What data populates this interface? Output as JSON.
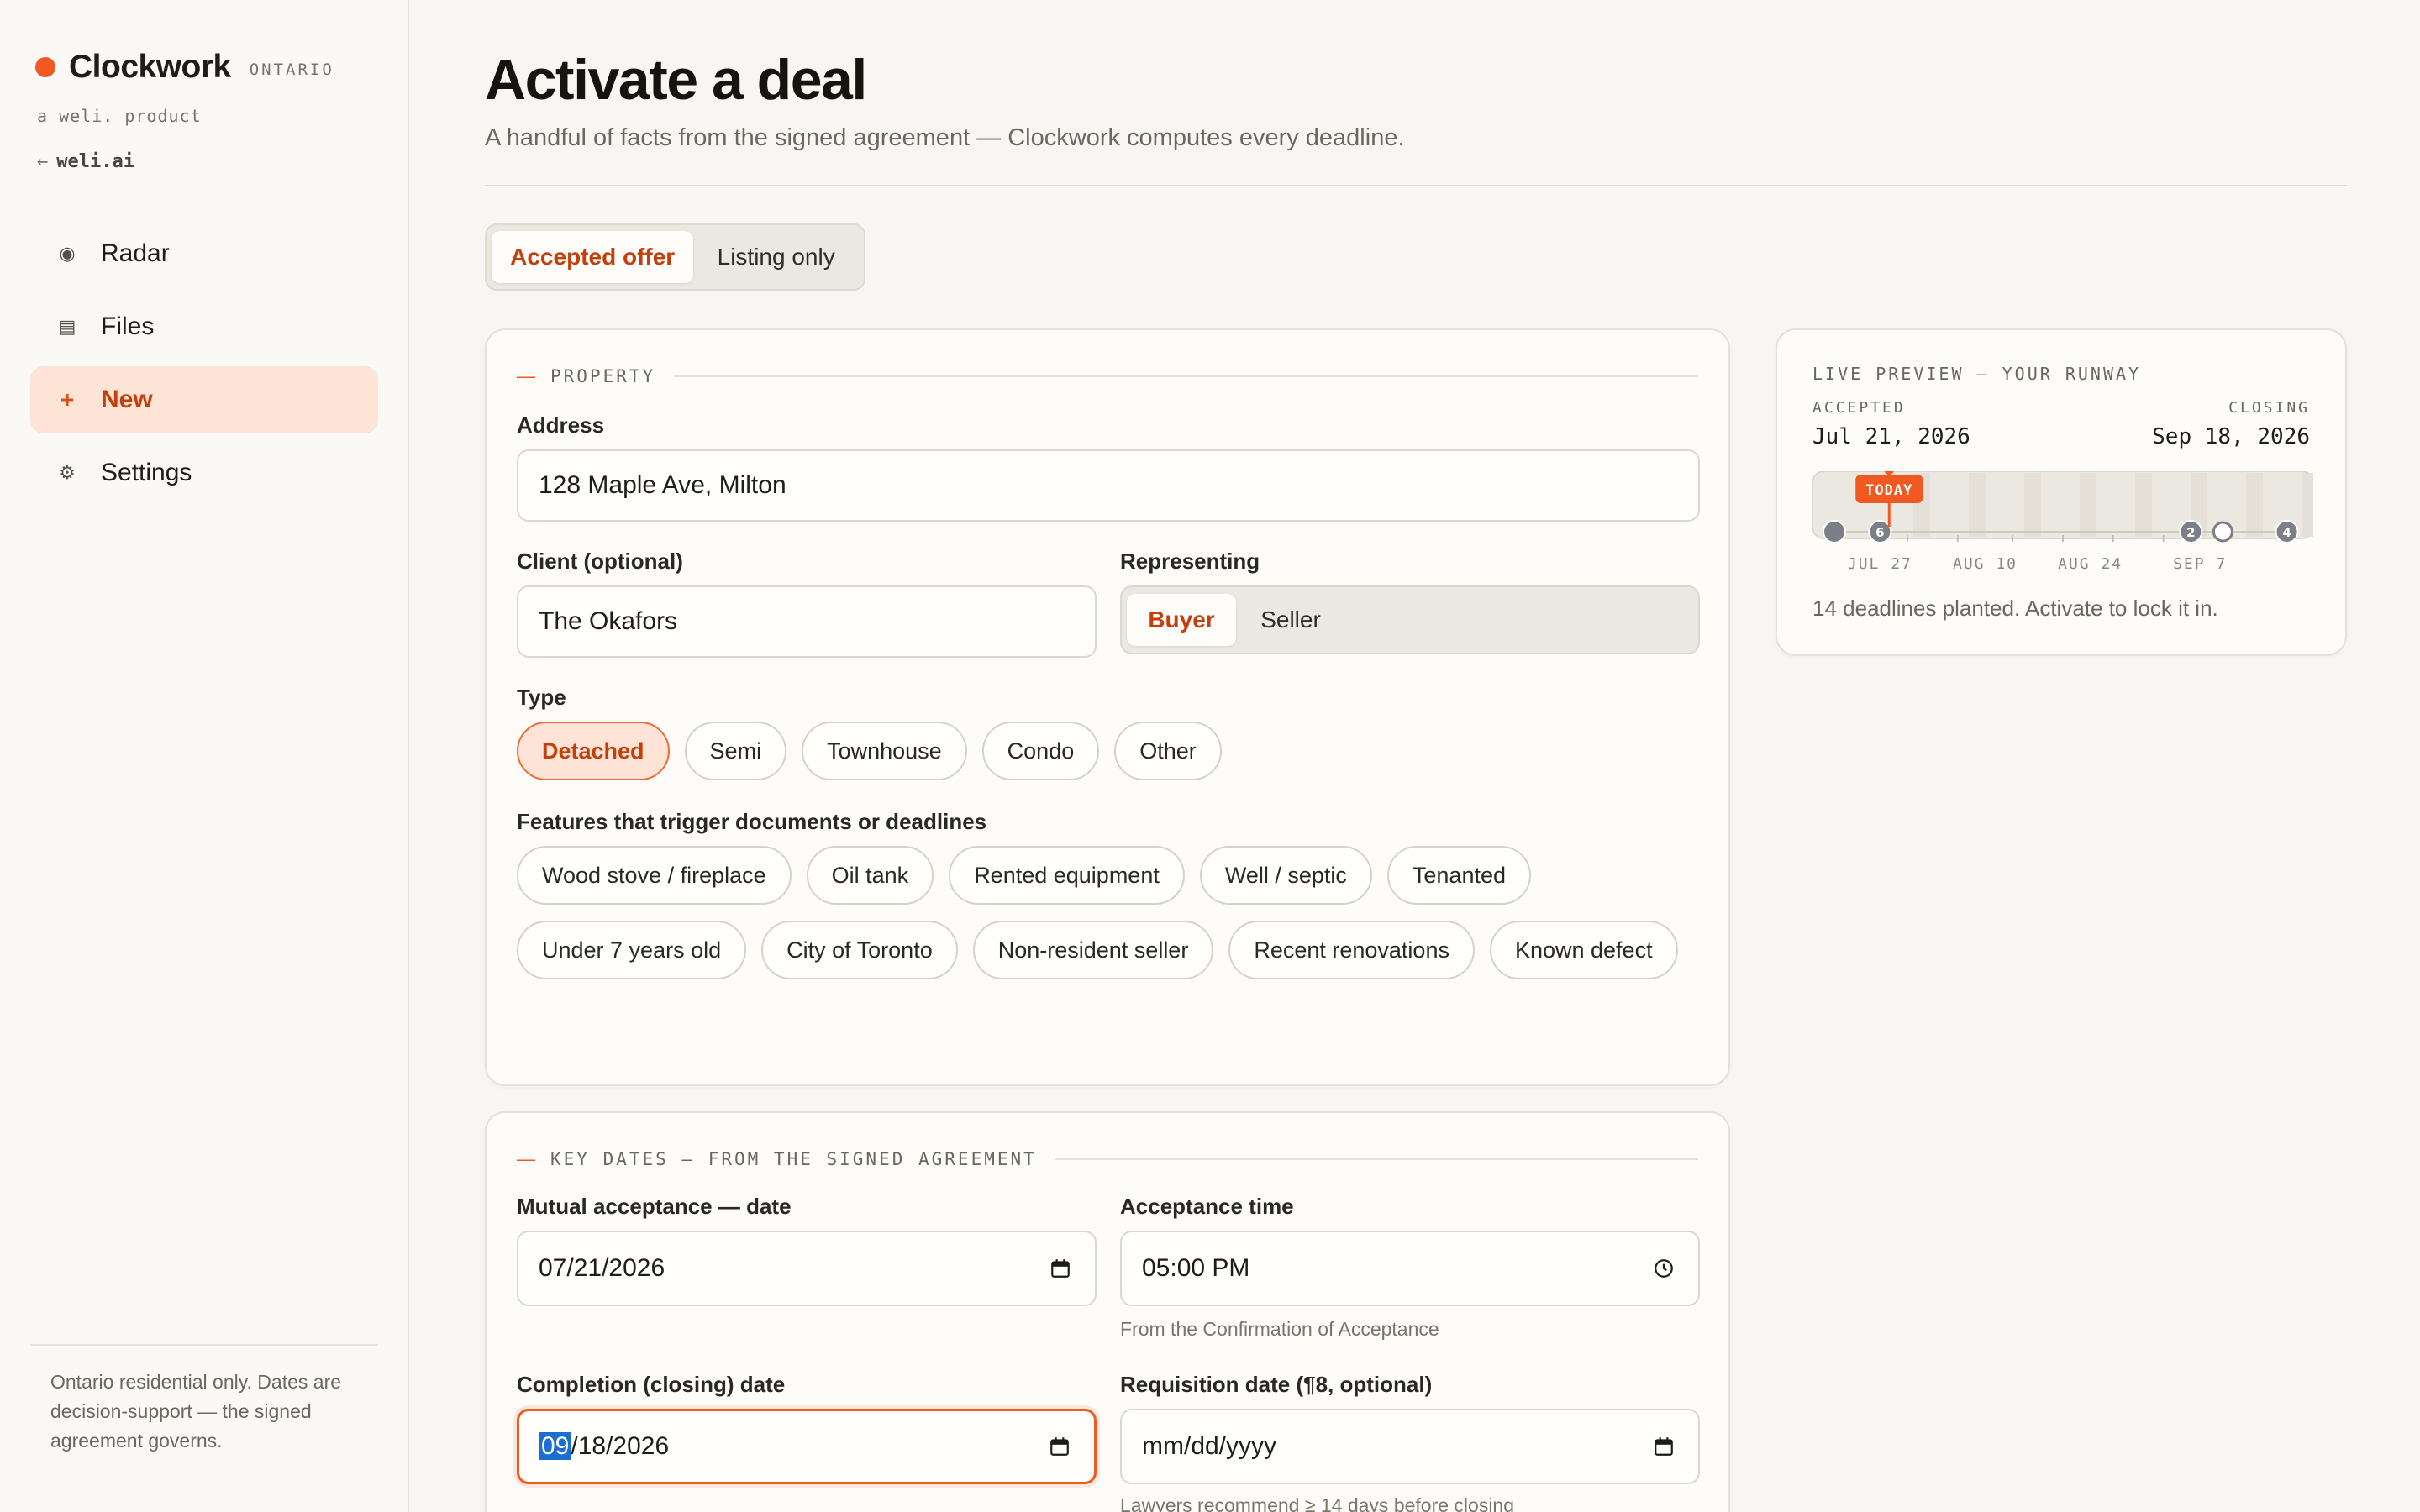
{
  "sidebar": {
    "brand_name": "Clockwork",
    "brand_region": "ONTARIO",
    "brand_sub": "a weli. product",
    "back_link": "weli.ai",
    "back_arrow": "←",
    "items": [
      {
        "label": "Radar",
        "icon": "radar-icon",
        "glyph": "◉"
      },
      {
        "label": "Files",
        "icon": "files-icon",
        "glyph": "▤"
      },
      {
        "label": "New",
        "icon": "plus-icon",
        "glyph": "+"
      },
      {
        "label": "Settings",
        "icon": "gear-icon",
        "glyph": "⚙"
      }
    ],
    "active_item": "New",
    "footer": "Ontario residential only. Dates are decision-support — the signed agreement governs."
  },
  "header": {
    "title": "Activate a deal",
    "subtitle": "A handful of facts from the signed agreement — Clockwork computes every deadline."
  },
  "mode": {
    "options": [
      "Accepted offer",
      "Listing only"
    ],
    "selected": "Accepted offer"
  },
  "property": {
    "section_title": "PROPERTY",
    "address_label": "Address",
    "address_value": "128 Maple Ave, Milton",
    "client_label": "Client (optional)",
    "client_value": "The Okafors",
    "representing_label": "Representing",
    "representing_options": [
      "Buyer",
      "Seller"
    ],
    "representing_selected": "Buyer",
    "type_label": "Type",
    "types": [
      "Detached",
      "Semi",
      "Townhouse",
      "Condo",
      "Other"
    ],
    "type_selected": "Detached",
    "features_label": "Features that trigger documents or deadlines",
    "features": [
      "Wood stove / fireplace",
      "Oil tank",
      "Rented equipment",
      "Well / septic",
      "Tenanted",
      "Under 7 years old",
      "City of Toronto",
      "Non-resident seller",
      "Recent renovations",
      "Known defect"
    ]
  },
  "dates": {
    "section_title": "KEY DATES — FROM THE SIGNED AGREEMENT",
    "acceptance_date_label": "Mutual acceptance — date",
    "acceptance_date_value": "07/21/2026",
    "acceptance_time_label": "Acceptance time",
    "acceptance_time_value": "05:00 PM",
    "acceptance_time_hint": "From the Confirmation of Acceptance",
    "completion_label": "Completion (closing) date",
    "completion_month_selected": "09",
    "completion_rest": "/18/2026",
    "requisition_label": "Requisition date (¶8, optional)",
    "requisition_placeholder": "mm/dd/yyyy",
    "requisition_hint": "Lawyers recommend ≥ 14 days before closing"
  },
  "preview": {
    "title": "LIVE PREVIEW — YOUR RUNWAY",
    "accepted_label": "ACCEPTED",
    "accepted_date": "Jul 21, 2026",
    "closing_label": "CLOSING",
    "closing_date": "Sep 18, 2026",
    "today_label": "TODAY",
    "today_fraction": 0.12,
    "ticks": [
      "JUL 27",
      "AUG 10",
      "AUG 24",
      "SEP 7"
    ],
    "markers": [
      {
        "fraction": 0.0,
        "count": ""
      },
      {
        "fraction": 0.1,
        "count": "6"
      },
      {
        "fraction": 0.78,
        "count": "2"
      },
      {
        "fraction": 0.85,
        "count": "",
        "hollow": true
      },
      {
        "fraction": 0.99,
        "count": "4"
      }
    ],
    "footer": "14 deadlines planted. Activate to lock it in.",
    "colors": {
      "accent": "#f05a22",
      "marker": "#7c7f88"
    }
  }
}
